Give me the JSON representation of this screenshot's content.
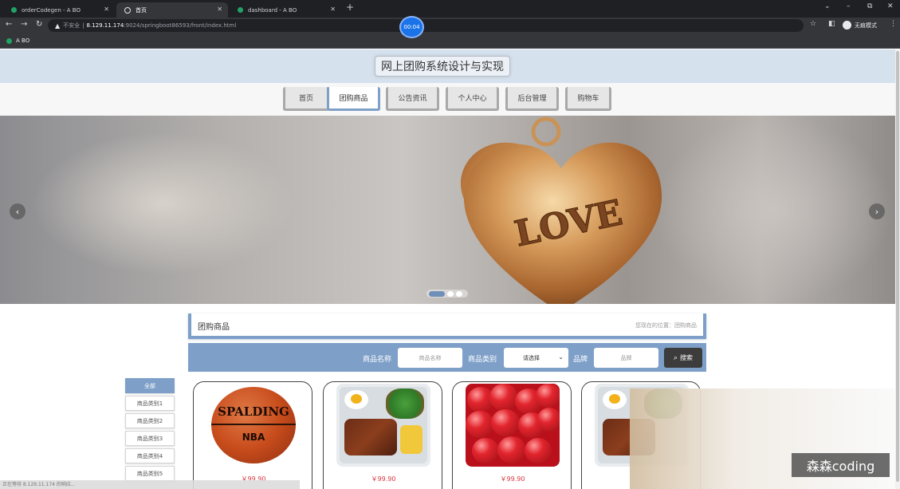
{
  "browser": {
    "tabs": [
      {
        "title": "orderCodegen - A BO",
        "active": false
      },
      {
        "title": "首页",
        "active": true
      },
      {
        "title": "dashboard - A BO",
        "active": false
      }
    ],
    "new_tab": "+",
    "window_controls": {
      "chevron": "⌄",
      "minimize": "–",
      "restore": "⧉",
      "close": "✕"
    },
    "address": {
      "security_label": "不安全",
      "separator": "|",
      "host": "8.129.11.174",
      "path": ":9024/springboot86593/front/index.html"
    },
    "recording_timer": "00:04",
    "profile_label": "无痕模式",
    "bookmark": "A BO"
  },
  "site": {
    "title": "网上团购系统设计与实现",
    "nav": [
      {
        "label": "首页",
        "active": false
      },
      {
        "label": "团购商品",
        "active": true
      },
      {
        "label": "公告资讯",
        "active": false
      },
      {
        "label": "个人中心",
        "active": false
      },
      {
        "label": "后台管理",
        "active": false
      },
      {
        "label": "购物车",
        "active": false
      }
    ],
    "banner": {
      "heart_text": "LOVE",
      "prev": "‹",
      "next": "›",
      "slide_count": 3,
      "active_slide": 1
    }
  },
  "section": {
    "title": "团购商品",
    "breadcrumb": "您现在的位置：团购商品"
  },
  "search": {
    "name_label": "商品名称",
    "name_placeholder": "商品名称",
    "category_label": "商品类别",
    "category_value": "请选择",
    "brand_label": "品牌",
    "brand_placeholder": "品牌",
    "button_label": "搜索"
  },
  "categories": [
    "全部",
    "商品类别1",
    "商品类别2",
    "商品类别3",
    "商品类别4",
    "商品类别5"
  ],
  "products": [
    {
      "image": "basketball",
      "brand_text": "SPALDING",
      "league_text": "NBA",
      "price": "￥99.90"
    },
    {
      "image": "bento",
      "price": "￥99.90"
    },
    {
      "image": "cherries",
      "price": "￥99.90"
    },
    {
      "image": "bento"
    }
  ],
  "watermark": "森森coding",
  "status_text": "正在等待 8.129.11.174 的响应..."
}
